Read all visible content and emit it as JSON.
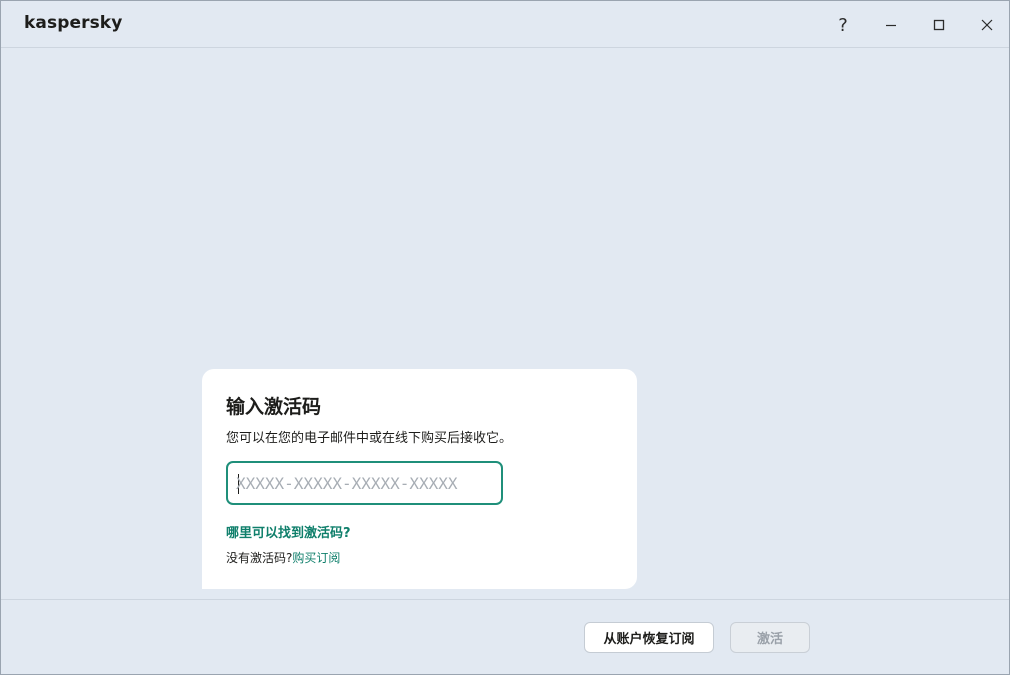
{
  "app": {
    "logo_text": "kaspersky"
  },
  "titlebar": {
    "help_glyph": "?",
    "icons": [
      "help-icon",
      "minimize-icon",
      "maximize-icon",
      "close-icon"
    ]
  },
  "card": {
    "title": "输入激活码",
    "description": "您可以在您的电子邮件中或在线下购买后接收它。",
    "code_input": {
      "value": "",
      "placeholder": "XXXXX-XXXXX-XXXXX-XXXXX"
    },
    "find_code_link": "哪里可以找到激活码?",
    "no_code_text": "没有激活码?",
    "buy_link": "购买订阅"
  },
  "footer": {
    "restore_button": "从账户恢复订阅",
    "activate_button": "激活"
  },
  "colors": {
    "accent": "#1f8f7a",
    "link": "#0f7f6b",
    "background": "#e2e9f2",
    "card": "#ffffff",
    "disabled_text": "#9aa1a9"
  }
}
